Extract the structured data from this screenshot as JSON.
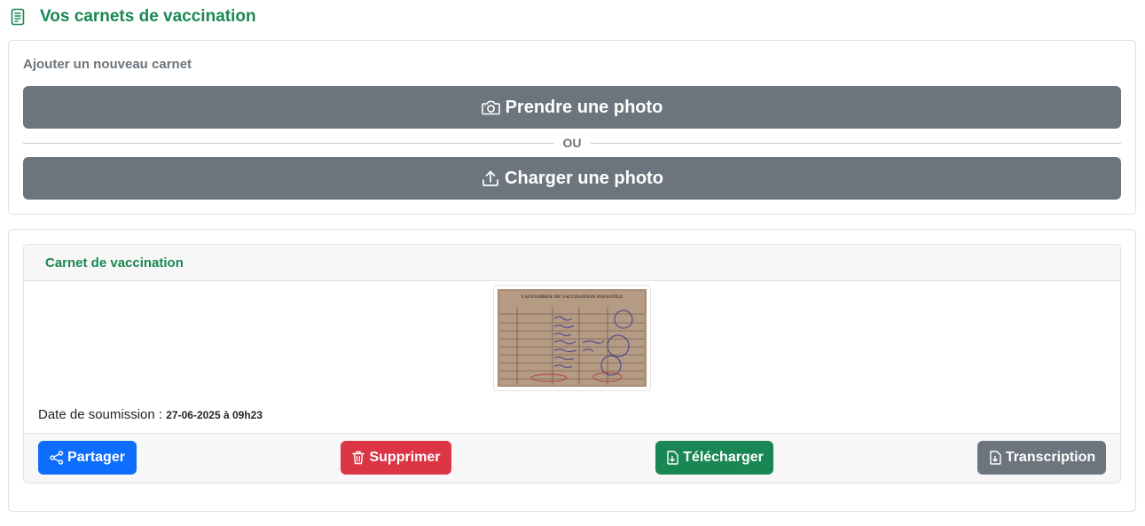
{
  "header": {
    "title": "Vos carnets de vaccination",
    "icon": "document-text-icon",
    "color": "#198754"
  },
  "add_card": {
    "heading": "Ajouter un nouveau carnet",
    "take_photo": {
      "label": "Prendre une photo",
      "icon": "camera-icon"
    },
    "separator": "OU",
    "upload_photo": {
      "label": "Charger une photo",
      "icon": "upload-icon"
    }
  },
  "carnet": {
    "title": "Carnet de vaccination",
    "image_caption": "CALENDRIER DE VACCINATION INFANTILE",
    "submission_label": "Date de soumission :",
    "submission_value": "27-06-2025 à 09h23",
    "actions": {
      "share": {
        "label": "Partager",
        "icon": "share-icon",
        "color": "#0d6efd"
      },
      "delete": {
        "label": "Supprimer",
        "icon": "trash-icon",
        "color": "#dc3545"
      },
      "download": {
        "label": "Télécharger",
        "icon": "file-download-icon",
        "color": "#198754"
      },
      "transcription": {
        "label": "Transcription",
        "icon": "file-download-icon",
        "color": "#6c757d"
      }
    }
  }
}
